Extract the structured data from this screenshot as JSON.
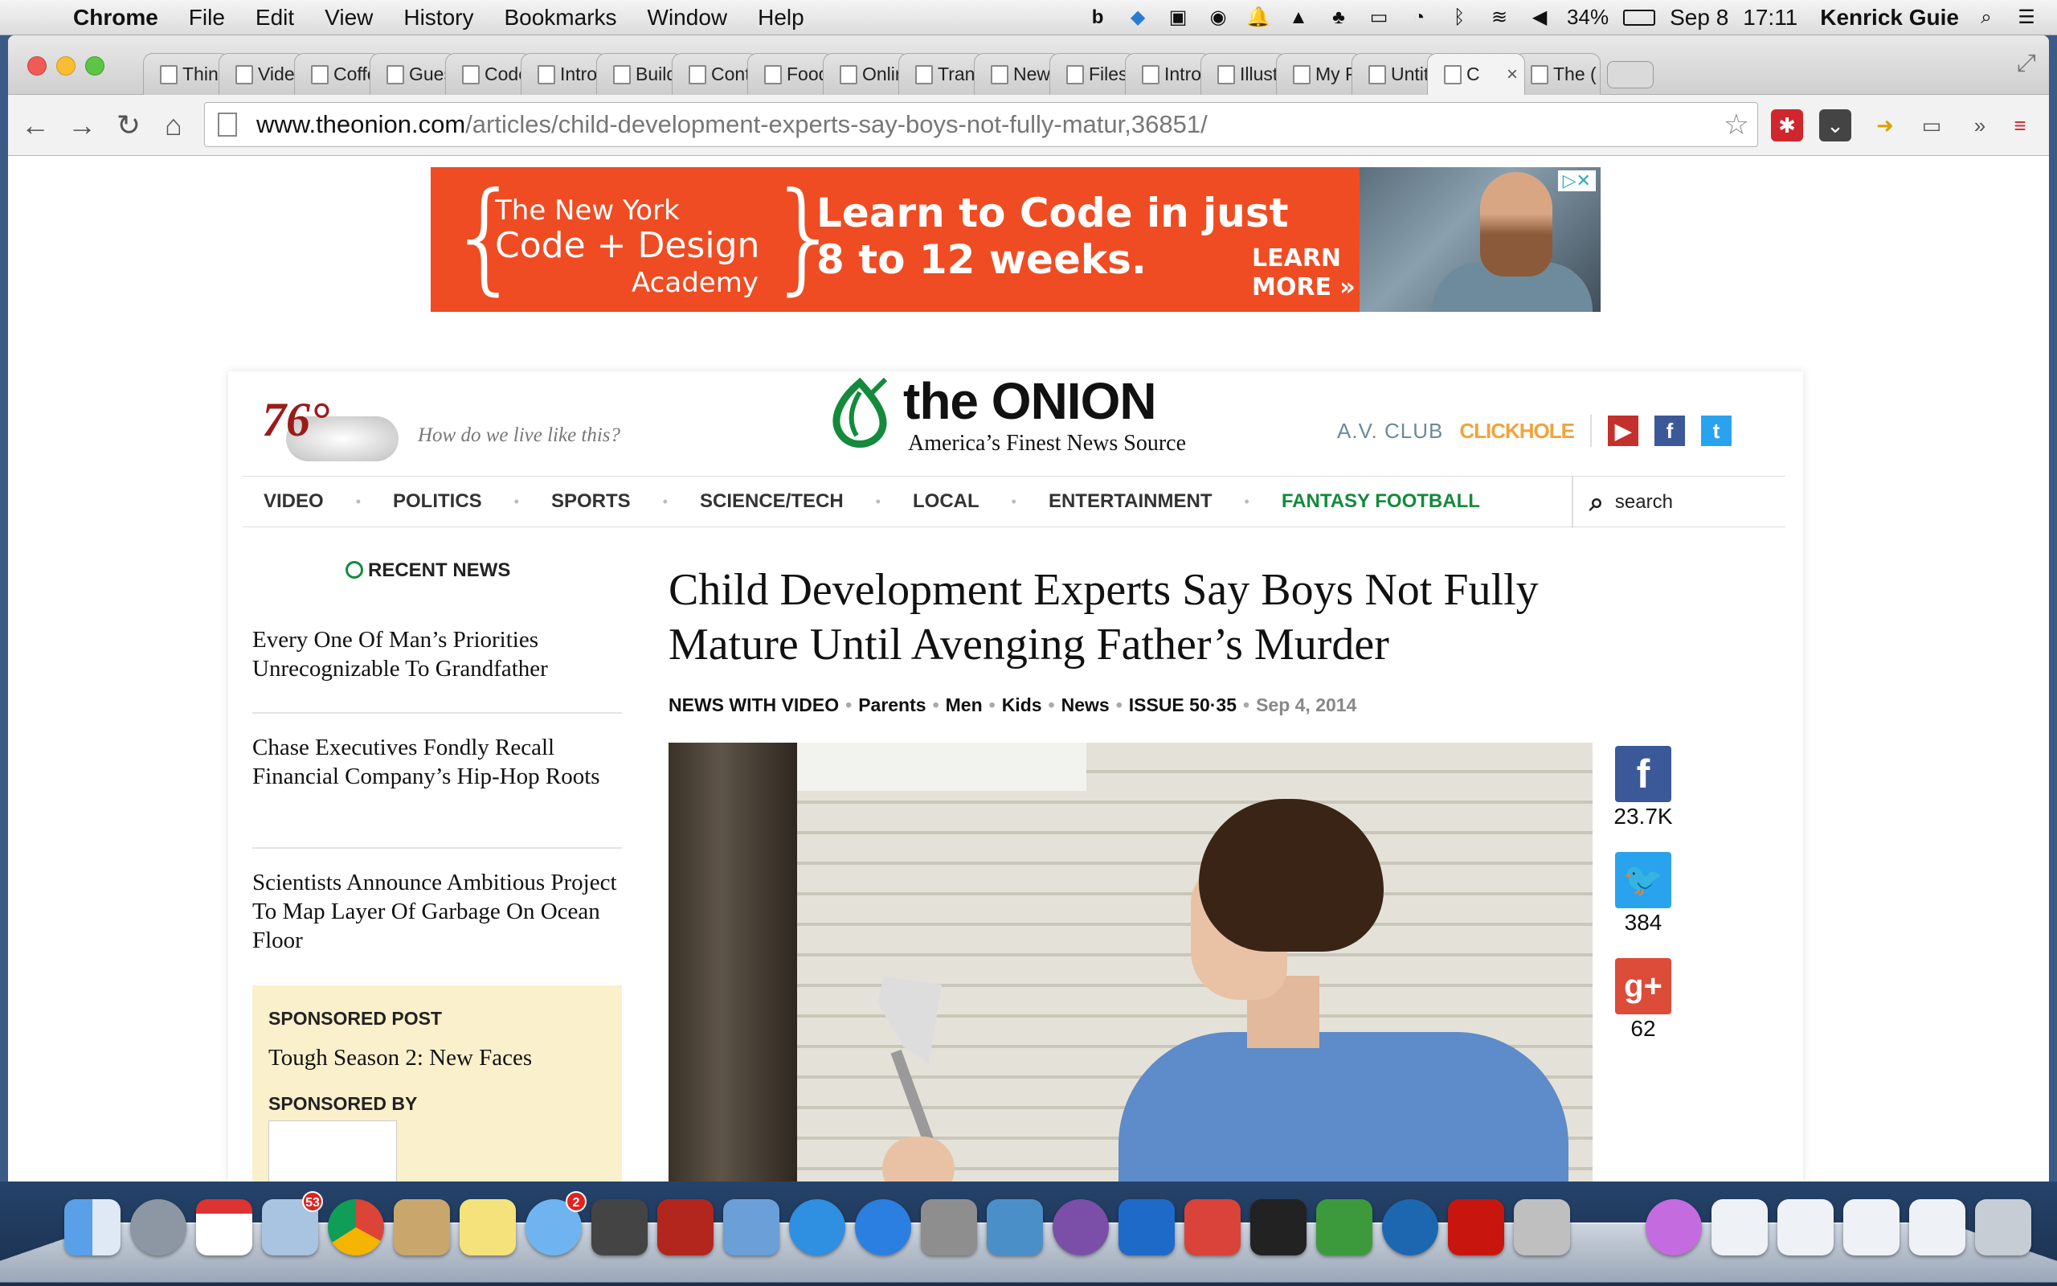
{
  "menubar": {
    "app": "Chrome",
    "items": [
      "File",
      "Edit",
      "View",
      "History",
      "Bookmarks",
      "Window",
      "Help"
    ],
    "battery": "34%",
    "date": "Sep 8",
    "time": "17:11",
    "user": "Kenrick Guie"
  },
  "tabs": [
    {
      "label": "Thin"
    },
    {
      "label": "Vide"
    },
    {
      "label": "Coffe"
    },
    {
      "label": "Gues"
    },
    {
      "label": "Code"
    },
    {
      "label": "Intro"
    },
    {
      "label": "Build"
    },
    {
      "label": "Cont"
    },
    {
      "label": "Food"
    },
    {
      "label": "Onlir"
    },
    {
      "label": "Tran"
    },
    {
      "label": "New Tal"
    },
    {
      "label": "Files"
    },
    {
      "label": "Intro"
    },
    {
      "label": "Illust"
    },
    {
      "label": "My P"
    },
    {
      "label": "Untit"
    },
    {
      "label": "C"
    },
    {
      "label": "The ("
    }
  ],
  "omnibox": {
    "host": "www.theonion.com",
    "path": "/articles/child-development-experts-say-boys-not-fully-matur,36851/"
  },
  "ad": {
    "brand_line1": "The New York",
    "brand_line2": "Code + Design",
    "brand_line3": "Academy",
    "headline_line1": "Learn to Code in just",
    "headline_line2": "8 to 12 weeks.",
    "cta_line1": "LEARN",
    "cta_line2": "MORE »"
  },
  "site": {
    "temperature": "76°",
    "tagline": "How do we live like this?",
    "logo_name": "the ONION",
    "logo_sub": "America’s Finest News Source",
    "partner1": "A.V. CLUB",
    "partner2": "CLICKHOLE",
    "nav": [
      "VIDEO",
      "POLITICS",
      "SPORTS",
      "SCIENCE/TECH",
      "LOCAL",
      "ENTERTAINMENT",
      "FANTASY FOOTBALL"
    ],
    "search_label": "search",
    "recent_news_label": "RECENT NEWS",
    "recent": [
      "Every One Of Man’s Priorities Unrecognizable To Grandfather",
      "Chase Executives Fondly Recall Financial Company’s Hip-Hop Roots",
      "Scientists Announce Ambitious Project To Map Layer Of Garbage On Ocean Floor"
    ],
    "sponsored_label": "SPONSORED POST",
    "sponsored_title": "Tough Season 2: New Faces",
    "sponsored_by_label": "SPONSORED BY"
  },
  "article": {
    "headline": "Child Development Experts Say Boys Not Fully Mature Until Avenging Father’s Murder",
    "meta": [
      "NEWS WITH VIDEO",
      "Parents",
      "Men",
      "Kids",
      "News",
      "ISSUE 50·35"
    ],
    "date": "Sep 4, 2014"
  },
  "share": {
    "facebook": "23.7K",
    "twitter": "384",
    "googleplus": "62"
  },
  "colors": {
    "onion_green": "#138a3c",
    "ad_orange": "#ef4c23",
    "avclub": "#6b8a9b",
    "clickhole": "#f2a33a"
  },
  "dock": {
    "mail_badge": "53",
    "messages_badge": "2"
  }
}
